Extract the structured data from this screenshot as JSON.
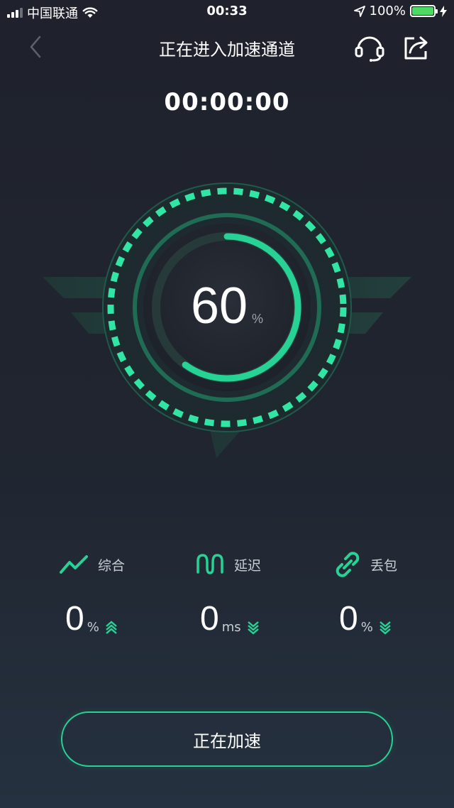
{
  "status_bar": {
    "carrier": "中国联通",
    "time": "00:33",
    "battery": "100%"
  },
  "nav": {
    "title": "正在进入加速通道",
    "icons": [
      "back-chevron-icon",
      "headset-icon",
      "share-icon"
    ]
  },
  "timer": "00:00:00",
  "gauge": {
    "value": "60",
    "unit": "%",
    "progress": 0.6
  },
  "stats": [
    {
      "label": "综合",
      "value": "0",
      "unit": "%",
      "icon": "trend-chart-icon",
      "arrow": "up"
    },
    {
      "label": "延迟",
      "value": "0",
      "unit": "ms",
      "icon": "wave-icon",
      "arrow": "down"
    },
    {
      "label": "丢包",
      "value": "0",
      "unit": "%",
      "icon": "link-icon",
      "arrow": "down"
    }
  ],
  "button": {
    "label": "正在加速"
  },
  "colors": {
    "accent": "#27d394",
    "background": "#1f2430",
    "text_secondary": "#c9ced4"
  }
}
